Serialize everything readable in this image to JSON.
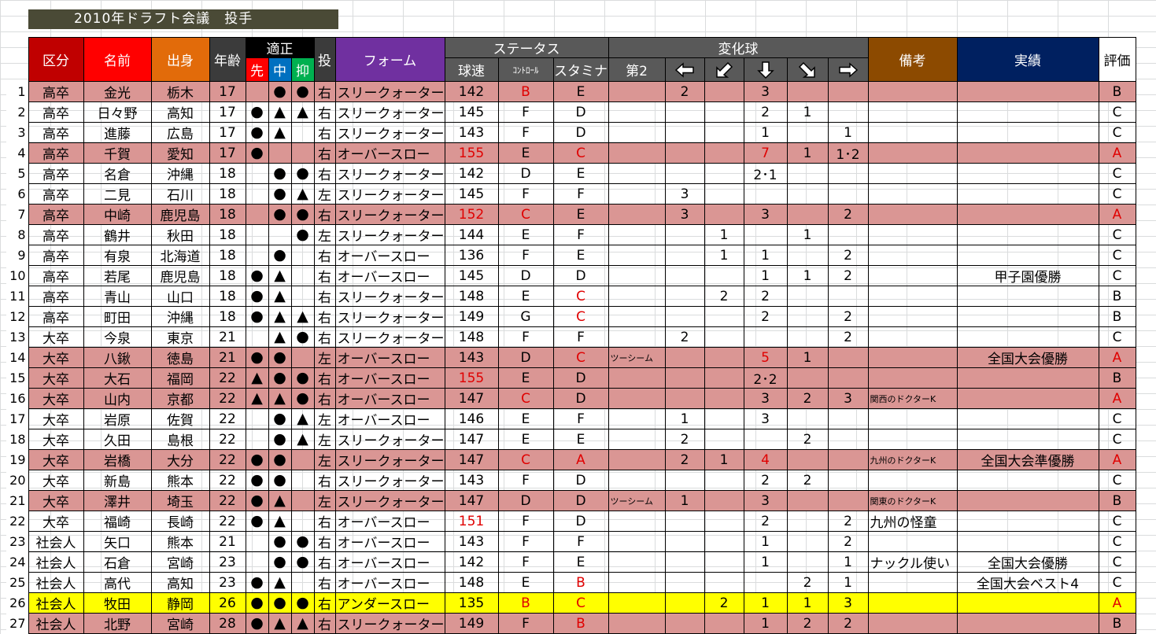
{
  "title": "2010年ドラフト会議　投手",
  "headers": {
    "kubun": "区分",
    "name": "名前",
    "origin": "出身",
    "age": "年齢",
    "aptitude": "適正",
    "sen": "先",
    "naka": "中",
    "osae": "抑",
    "throw": "投",
    "form": "フォーム",
    "status": "ステータス",
    "speed": "球速",
    "control": "ｺﾝﾄﾛｰﾙ",
    "stamina": "スタミナ",
    "breaking": "変化球",
    "second": "第2",
    "notes": "備考",
    "record": "実績",
    "rating": "評価"
  },
  "arrow_icons": [
    "arrow-left-icon",
    "arrow-down-left-icon",
    "arrow-down-icon",
    "arrow-down-right-icon",
    "arrow-right-icon"
  ],
  "colors": {
    "row_pink": "#da9694",
    "row_yellow": "#ffff00",
    "highlight_red": "#e00000",
    "title_bg": "#4a4a36",
    "kubun_header": "#c00000",
    "name_header": "#ff0000",
    "origin_header": "#e26b0a",
    "form_header": "#7030a0",
    "status_header": "#595959",
    "notes_header": "#8c4a00",
    "record_header": "#002060"
  },
  "rows": [
    {
      "n": "1",
      "kubun": "高卒",
      "name": "金光",
      "origin": "栃木",
      "age": "17",
      "sen": "",
      "naka": "●",
      "osae": "●",
      "throw": "右",
      "form": "スリークォーター",
      "speed": "142",
      "control": "B",
      "stamina": "E",
      "second": "",
      "left": "2",
      "dleft": "",
      "down": "3",
      "dright": "",
      "right": "",
      "notes": "",
      "record": "",
      "rating": "B",
      "hl": "pink",
      "red": [
        "control"
      ]
    },
    {
      "n": "2",
      "kubun": "高卒",
      "name": "日々野",
      "origin": "高知",
      "age": "17",
      "sen": "●",
      "naka": "▲",
      "osae": "▲",
      "throw": "右",
      "form": "スリークォーター",
      "speed": "145",
      "control": "F",
      "stamina": "D",
      "second": "",
      "left": "",
      "dleft": "",
      "down": "2",
      "dright": "1",
      "right": "",
      "notes": "",
      "record": "",
      "rating": "C",
      "hl": "",
      "red": []
    },
    {
      "n": "3",
      "kubun": "高卒",
      "name": "進藤",
      "origin": "広島",
      "age": "17",
      "sen": "●",
      "naka": "▲",
      "osae": "",
      "throw": "右",
      "form": "スリークォーター",
      "speed": "143",
      "control": "F",
      "stamina": "D",
      "second": "",
      "left": "",
      "dleft": "",
      "down": "1",
      "dright": "",
      "right": "1",
      "notes": "",
      "record": "",
      "rating": "C",
      "hl": "",
      "red": []
    },
    {
      "n": "4",
      "kubun": "高卒",
      "name": "千賀",
      "origin": "愛知",
      "age": "17",
      "sen": "●",
      "naka": "",
      "osae": "",
      "throw": "右",
      "form": "オーバースロー",
      "speed": "155",
      "control": "E",
      "stamina": "C",
      "second": "",
      "left": "",
      "dleft": "",
      "down": "7",
      "dright": "1",
      "right": "1･2",
      "notes": "",
      "record": "",
      "rating": "A",
      "hl": "pink",
      "red": [
        "speed",
        "stamina",
        "down",
        "rating"
      ]
    },
    {
      "n": "5",
      "kubun": "高卒",
      "name": "名倉",
      "origin": "沖縄",
      "age": "18",
      "sen": "",
      "naka": "●",
      "osae": "●",
      "throw": "右",
      "form": "スリークォーター",
      "speed": "142",
      "control": "D",
      "stamina": "E",
      "second": "",
      "left": "",
      "dleft": "",
      "down": "2･1",
      "dright": "",
      "right": "",
      "notes": "",
      "record": "",
      "rating": "C",
      "hl": "",
      "red": []
    },
    {
      "n": "6",
      "kubun": "高卒",
      "name": "二見",
      "origin": "石川",
      "age": "18",
      "sen": "",
      "naka": "●",
      "osae": "▲",
      "throw": "左",
      "form": "スリークォーター",
      "speed": "145",
      "control": "F",
      "stamina": "F",
      "second": "",
      "left": "3",
      "dleft": "",
      "down": "",
      "dright": "",
      "right": "",
      "notes": "",
      "record": "",
      "rating": "C",
      "hl": "",
      "red": []
    },
    {
      "n": "7",
      "kubun": "高卒",
      "name": "中崎",
      "origin": "鹿児島",
      "age": "18",
      "sen": "",
      "naka": "●",
      "osae": "●",
      "throw": "右",
      "form": "スリークォーター",
      "speed": "152",
      "control": "C",
      "stamina": "E",
      "second": "",
      "left": "3",
      "dleft": "",
      "down": "3",
      "dright": "",
      "right": "2",
      "notes": "",
      "record": "",
      "rating": "A",
      "hl": "pink",
      "red": [
        "speed",
        "control",
        "rating"
      ]
    },
    {
      "n": "8",
      "kubun": "高卒",
      "name": "鶴井",
      "origin": "秋田",
      "age": "18",
      "sen": "",
      "naka": "",
      "osae": "●",
      "throw": "左",
      "form": "スリークォーター",
      "speed": "144",
      "control": "E",
      "stamina": "F",
      "second": "",
      "left": "",
      "dleft": "1",
      "dright": "1",
      "down": "",
      "right": "",
      "notes": "",
      "record": "",
      "rating": "C",
      "hl": "",
      "red": []
    },
    {
      "n": "9",
      "kubun": "高卒",
      "name": "有泉",
      "origin": "北海道",
      "age": "18",
      "sen": "",
      "naka": "●",
      "osae": "",
      "throw": "右",
      "form": "オーバースロー",
      "speed": "136",
      "control": "F",
      "stamina": "E",
      "second": "",
      "left": "",
      "dleft": "1",
      "down": "1",
      "dright": "",
      "right": "2",
      "notes": "",
      "record": "",
      "rating": "C",
      "hl": "",
      "red": []
    },
    {
      "n": "10",
      "kubun": "高卒",
      "name": "若尾",
      "origin": "鹿児島",
      "age": "18",
      "sen": "●",
      "naka": "▲",
      "osae": "",
      "throw": "右",
      "form": "オーバースロー",
      "speed": "145",
      "control": "D",
      "stamina": "D",
      "second": "",
      "left": "",
      "dleft": "",
      "down": "1",
      "dright": "1",
      "right": "2",
      "notes": "",
      "record": "甲子園優勝",
      "rating": "C",
      "hl": "",
      "red": []
    },
    {
      "n": "11",
      "kubun": "高卒",
      "name": "青山",
      "origin": "山口",
      "age": "18",
      "sen": "●",
      "naka": "▲",
      "osae": "",
      "throw": "右",
      "form": "スリークォーター",
      "speed": "148",
      "control": "E",
      "stamina": "C",
      "second": "",
      "left": "",
      "dleft": "2",
      "down": "2",
      "dright": "",
      "right": "",
      "notes": "",
      "record": "",
      "rating": "B",
      "hl": "",
      "red": [
        "stamina"
      ]
    },
    {
      "n": "12",
      "kubun": "高卒",
      "name": "町田",
      "origin": "沖縄",
      "age": "18",
      "sen": "●",
      "naka": "▲",
      "osae": "▲",
      "throw": "右",
      "form": "スリークォーター",
      "speed": "149",
      "control": "G",
      "stamina": "C",
      "second": "",
      "left": "",
      "dleft": "",
      "down": "2",
      "dright": "",
      "right": "2",
      "notes": "",
      "record": "",
      "rating": "B",
      "hl": "",
      "red": [
        "stamina"
      ]
    },
    {
      "n": "13",
      "kubun": "大卒",
      "name": "今泉",
      "origin": "東京",
      "age": "21",
      "sen": "",
      "naka": "▲",
      "osae": "●",
      "throw": "右",
      "form": "スリークォーター",
      "speed": "148",
      "control": "F",
      "stamina": "F",
      "second": "",
      "left": "2",
      "dleft": "",
      "down": "",
      "dright": "",
      "right": "2",
      "notes": "",
      "record": "",
      "rating": "C",
      "hl": "",
      "red": []
    },
    {
      "n": "14",
      "kubun": "大卒",
      "name": "八鍬",
      "origin": "徳島",
      "age": "21",
      "sen": "●",
      "naka": "●",
      "osae": "",
      "throw": "左",
      "form": "オーバースロー",
      "speed": "143",
      "control": "D",
      "stamina": "C",
      "second": "ツーシーム",
      "left": "",
      "dleft": "",
      "down": "5",
      "dright": "1",
      "right": "",
      "notes": "",
      "record": "全国大会優勝",
      "rating": "A",
      "hl": "pink",
      "red": [
        "stamina",
        "down",
        "rating"
      ]
    },
    {
      "n": "15",
      "kubun": "大卒",
      "name": "大石",
      "origin": "福岡",
      "age": "22",
      "sen": "▲",
      "naka": "●",
      "osae": "●",
      "throw": "右",
      "form": "オーバースロー",
      "speed": "155",
      "control": "E",
      "stamina": "D",
      "second": "",
      "left": "",
      "dleft": "",
      "down": "2･2",
      "dright": "",
      "right": "",
      "notes": "",
      "record": "",
      "rating": "B",
      "hl": "pink",
      "red": [
        "speed"
      ]
    },
    {
      "n": "16",
      "kubun": "大卒",
      "name": "山内",
      "origin": "京都",
      "age": "22",
      "sen": "▲",
      "naka": "▲",
      "osae": "●",
      "throw": "右",
      "form": "オーバースロー",
      "speed": "147",
      "control": "C",
      "stamina": "D",
      "second": "",
      "left": "",
      "dleft": "",
      "down": "3",
      "dright": "2",
      "right": "3",
      "notes": "関西のドクターK",
      "record": "",
      "rating": "A",
      "hl": "pink",
      "red": [
        "control",
        "rating"
      ]
    },
    {
      "n": "17",
      "kubun": "大卒",
      "name": "岩原",
      "origin": "佐賀",
      "age": "22",
      "sen": "",
      "naka": "●",
      "osae": "▲",
      "throw": "左",
      "form": "オーバースロー",
      "speed": "146",
      "control": "E",
      "stamina": "F",
      "second": "",
      "left": "1",
      "dleft": "",
      "down": "3",
      "dright": "",
      "right": "",
      "notes": "",
      "record": "",
      "rating": "C",
      "hl": "",
      "red": []
    },
    {
      "n": "18",
      "kubun": "大卒",
      "name": "久田",
      "origin": "島根",
      "age": "22",
      "sen": "",
      "naka": "●",
      "osae": "▲",
      "throw": "左",
      "form": "スリークォーター",
      "speed": "147",
      "control": "E",
      "stamina": "E",
      "second": "",
      "left": "2",
      "dleft": "",
      "down": "",
      "dright": "2",
      "right": "",
      "notes": "",
      "record": "",
      "rating": "C",
      "hl": "",
      "red": []
    },
    {
      "n": "19",
      "kubun": "大卒",
      "name": "岩橋",
      "origin": "大分",
      "age": "22",
      "sen": "●",
      "naka": "●",
      "osae": "",
      "throw": "左",
      "form": "スリークォーター",
      "speed": "147",
      "control": "C",
      "stamina": "A",
      "second": "",
      "left": "2",
      "dleft": "1",
      "down": "4",
      "dright": "",
      "right": "",
      "notes": "九州のドクターK",
      "record": "全国大会準優勝",
      "rating": "A",
      "hl": "pink",
      "red": [
        "control",
        "stamina",
        "down",
        "rating"
      ]
    },
    {
      "n": "20",
      "kubun": "大卒",
      "name": "新島",
      "origin": "熊本",
      "age": "22",
      "sen": "●",
      "naka": "●",
      "osae": "",
      "throw": "右",
      "form": "スリークォーター",
      "speed": "143",
      "control": "F",
      "stamina": "D",
      "second": "",
      "left": "",
      "dleft": "",
      "down": "2",
      "dright": "2",
      "right": "",
      "notes": "",
      "record": "",
      "rating": "C",
      "hl": "",
      "red": []
    },
    {
      "n": "21",
      "kubun": "大卒",
      "name": "澤井",
      "origin": "埼玉",
      "age": "22",
      "sen": "●",
      "naka": "▲",
      "osae": "",
      "throw": "左",
      "form": "スリークォーター",
      "speed": "147",
      "control": "D",
      "stamina": "D",
      "second": "ツーシーム",
      "left": "1",
      "dleft": "",
      "down": "3",
      "dright": "",
      "right": "",
      "notes": "関東のドクターK",
      "record": "",
      "rating": "B",
      "hl": "pink",
      "red": []
    },
    {
      "n": "22",
      "kubun": "大卒",
      "name": "福崎",
      "origin": "長崎",
      "age": "22",
      "sen": "●",
      "naka": "▲",
      "osae": "",
      "throw": "右",
      "form": "オーバースロー",
      "speed": "151",
      "control": "F",
      "stamina": "D",
      "second": "",
      "left": "",
      "dleft": "",
      "down": "2",
      "dright": "",
      "right": "2",
      "notes": "九州の怪童",
      "record": "",
      "rating": "C",
      "hl": "",
      "red": [
        "speed"
      ]
    },
    {
      "n": "23",
      "kubun": "社会人",
      "name": "矢口",
      "origin": "熊本",
      "age": "21",
      "sen": "",
      "naka": "●",
      "osae": "●",
      "throw": "右",
      "form": "オーバースロー",
      "speed": "143",
      "control": "F",
      "stamina": "F",
      "second": "",
      "left": "",
      "dleft": "",
      "down": "1",
      "dright": "",
      "right": "2",
      "notes": "",
      "record": "",
      "rating": "C",
      "hl": "",
      "red": []
    },
    {
      "n": "24",
      "kubun": "社会人",
      "name": "石倉",
      "origin": "宮崎",
      "age": "23",
      "sen": "",
      "naka": "●",
      "osae": "●",
      "throw": "右",
      "form": "オーバースロー",
      "speed": "142",
      "control": "F",
      "stamina": "E",
      "second": "",
      "left": "",
      "dleft": "",
      "down": "1",
      "dright": "",
      "right": "1",
      "notes": "ナックル使い",
      "record": "全国大会優勝",
      "rating": "C",
      "hl": "",
      "red": []
    },
    {
      "n": "25",
      "kubun": "社会人",
      "name": "高代",
      "origin": "高知",
      "age": "23",
      "sen": "●",
      "naka": "▲",
      "osae": "",
      "throw": "右",
      "form": "オーバースロー",
      "speed": "148",
      "control": "E",
      "stamina": "B",
      "second": "",
      "left": "",
      "dleft": "",
      "down": "",
      "dright": "2",
      "right": "1",
      "notes": "",
      "record": "全国大会ベスト4",
      "rating": "C",
      "hl": "",
      "red": [
        "stamina"
      ]
    },
    {
      "n": "26",
      "kubun": "社会人",
      "name": "牧田",
      "origin": "静岡",
      "age": "26",
      "sen": "●",
      "naka": "●",
      "osae": "●",
      "throw": "右",
      "form": "アンダースロー",
      "speed": "135",
      "control": "B",
      "stamina": "C",
      "second": "",
      "left": "",
      "dleft": "2",
      "down": "1",
      "dright": "1",
      "right": "3",
      "notes": "",
      "record": "",
      "rating": "A",
      "hl": "yellow",
      "red": [
        "control",
        "stamina",
        "rating"
      ]
    },
    {
      "n": "27",
      "kubun": "社会人",
      "name": "北野",
      "origin": "宮崎",
      "age": "28",
      "sen": "●",
      "naka": "▲",
      "osae": "▲",
      "throw": "右",
      "form": "スリークォーター",
      "speed": "149",
      "control": "F",
      "stamina": "B",
      "second": "",
      "left": "",
      "dleft": "",
      "down": "1",
      "dright": "2",
      "right": "2",
      "notes": "",
      "record": "",
      "rating": "B",
      "hl": "pink",
      "red": [
        "stamina"
      ]
    }
  ]
}
